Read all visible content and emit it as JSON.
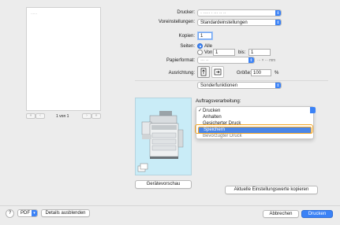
{
  "preview": {
    "page_header_text": "······",
    "page_counter": "1 von 1"
  },
  "printer": {
    "label": "Drucker:",
    "value": "· ·····  · ··· ·· ··"
  },
  "presets": {
    "label": "Voreinstellungen:",
    "value": "Standardeinstellungen"
  },
  "copies": {
    "label": "Kopien:",
    "value": "1"
  },
  "pages": {
    "label": "Seiten:",
    "all_label": "Alle",
    "from_label": "Von:",
    "from_value": "1",
    "to_label": "bis:",
    "to_value": "1"
  },
  "paper": {
    "label": "Papierformat:",
    "value": "··· ··",
    "dims": "··· × ··· mm"
  },
  "orientation": {
    "label": "Ausrichtung:",
    "portrait_icon": "portrait-icon",
    "landscape_icon": "landscape-icon"
  },
  "size": {
    "label": "Größe:",
    "value": "100",
    "unit": "%"
  },
  "section": {
    "value": "Sonderfunktionen"
  },
  "job": {
    "label": "Auftragsverarbeitung:",
    "menu_items": [
      "Drucken",
      "Anhalten",
      "Gesicherter Druck",
      "Speichern",
      "Bevorzugter Druck"
    ],
    "checked_item": "Drucken",
    "highlighted_item": "Speichern"
  },
  "device_preview_button": "Gerätevorschau",
  "update_settings_button": "Aktuelle Einstellungswerte kopieren",
  "footer": {
    "help": "?",
    "pdf": "PDF",
    "hide_details": "Details ausblenden",
    "cancel": "Abbrechen",
    "print": "Drucken"
  },
  "colors": {
    "accent": "#3b82f6",
    "highlight": "#4a86e8",
    "focus_ring": "#f5a623",
    "preview_bg": "#c9ecf7"
  }
}
